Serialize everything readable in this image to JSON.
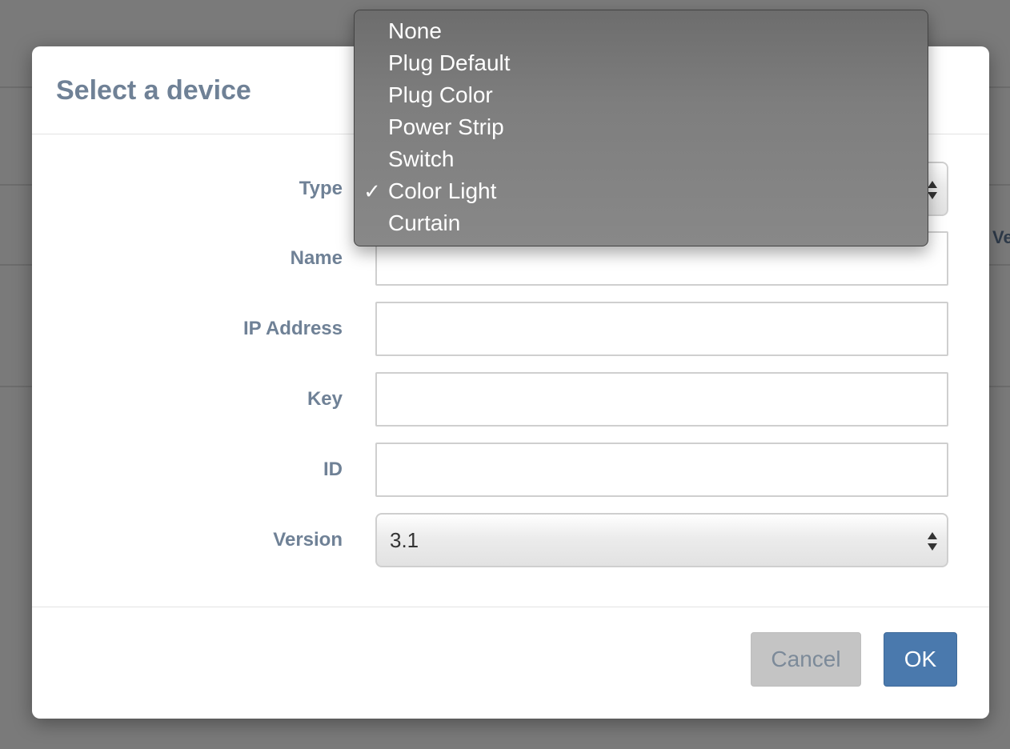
{
  "background": {
    "edge_text": "Ve"
  },
  "modal": {
    "title": "Select a device",
    "fields": {
      "type": {
        "label": "Type"
      },
      "name": {
        "label": "Name",
        "value": ""
      },
      "ip": {
        "label": "IP Address",
        "value": ""
      },
      "key": {
        "label": "Key",
        "value": ""
      },
      "id": {
        "label": "ID",
        "value": ""
      },
      "version": {
        "label": "Version",
        "value": "3.1"
      }
    },
    "buttons": {
      "cancel": "Cancel",
      "ok": "OK"
    }
  },
  "dropdown": {
    "selected": "Color Light",
    "options": [
      "None",
      "Plug Default",
      "Plug Color",
      "Power Strip",
      "Switch",
      "Color Light",
      "Curtain"
    ],
    "check_glyph": "✓",
    "check_icon": "checkmark-icon"
  },
  "colors": {
    "overlay": "#7a7a7a",
    "label": "#6f8196",
    "primary": "#4a79ad",
    "cancel_bg": "#c4c4c4"
  }
}
